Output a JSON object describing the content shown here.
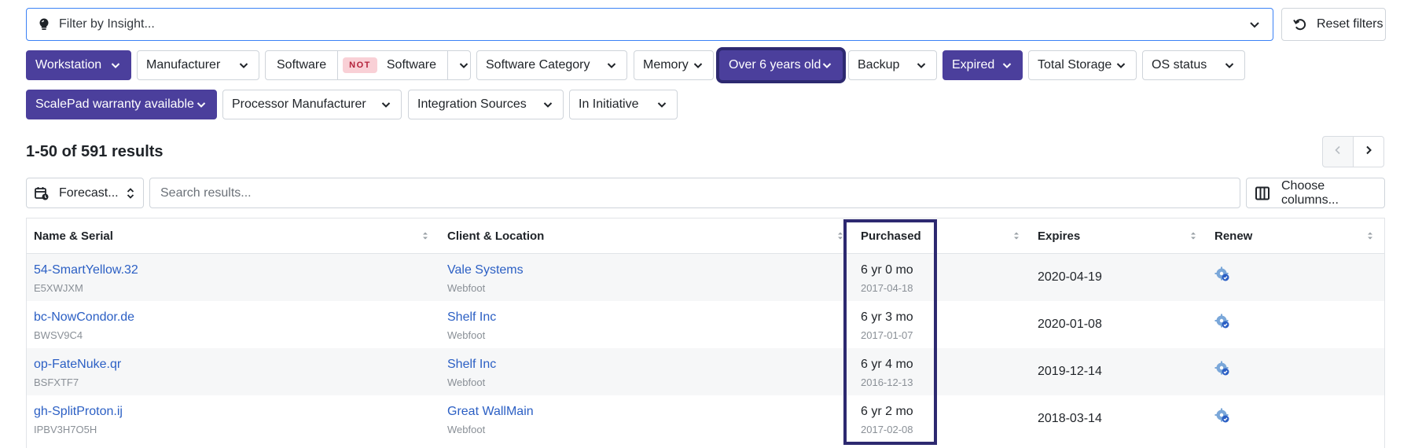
{
  "filter_bar": {
    "insight_placeholder": "Filter by Insight...",
    "reset_label": "Reset filters"
  },
  "chips": [
    {
      "id": "workstation",
      "label": "Workstation",
      "active": true
    },
    {
      "id": "manufacturer",
      "label": "Manufacturer",
      "active": false
    },
    {
      "id": "software",
      "label": "Software",
      "not_badge": "NOT",
      "label2": "Software",
      "active": false
    },
    {
      "id": "software_category",
      "label": "Software Category",
      "active": false
    },
    {
      "id": "memory",
      "label": "Memory",
      "active": false
    },
    {
      "id": "over6",
      "label": "Over 6 years old",
      "active": true
    },
    {
      "id": "backup",
      "label": "Backup",
      "active": false
    },
    {
      "id": "expired",
      "label": "Expired",
      "active": true
    },
    {
      "id": "total_storage",
      "label": "Total Storage",
      "active": false
    },
    {
      "id": "os_status",
      "label": "OS status",
      "active": false
    },
    {
      "id": "scalepad",
      "label": "ScalePad warranty available",
      "active": true
    },
    {
      "id": "processor",
      "label": "Processor Manufacturer",
      "active": false
    },
    {
      "id": "integration",
      "label": "Integration Sources",
      "active": false
    },
    {
      "id": "initiative",
      "label": "In Initiative",
      "active": false
    }
  ],
  "results": {
    "count_text": "1-50 of 591 results"
  },
  "toolbar": {
    "forecast_label": "Forecast...",
    "search_placeholder": "Search results...",
    "choose_columns_label": "Choose columns..."
  },
  "table": {
    "columns": [
      "Name & Serial",
      "Client & Location",
      "Purchased",
      "Expires",
      "Renew"
    ],
    "rows": [
      {
        "name": "54-SmartYellow.32",
        "serial": "E5XWJXM",
        "client": "Vale Systems",
        "location": "Webfoot",
        "purchased_age": "6 yr 0 mo",
        "purchased_date": "2017-04-18",
        "expires": "2020-04-19"
      },
      {
        "name": "bc-NowCondor.de",
        "serial": "BWSV9C4",
        "client": "Shelf Inc",
        "location": "Webfoot",
        "purchased_age": "6 yr 3 mo",
        "purchased_date": "2017-01-07",
        "expires": "2020-01-08"
      },
      {
        "name": "op-FateNuke.qr",
        "serial": "BSFXTF7",
        "client": "Shelf Inc",
        "location": "Webfoot",
        "purchased_age": "6 yr 4 mo",
        "purchased_date": "2016-12-13",
        "expires": "2019-12-14"
      },
      {
        "name": "gh-SplitProton.ij",
        "serial": "IPBV3H7O5H",
        "client": "Great WallMain",
        "location": "Webfoot",
        "purchased_age": "6 yr 2 mo",
        "purchased_date": "2017-02-08",
        "expires": "2018-03-14"
      }
    ]
  },
  "colors": {
    "chip_active": "#4b3f9c",
    "link": "#2b5fc4",
    "highlight": "#2d2970",
    "not_badge_bg": "#f9d0d6"
  }
}
